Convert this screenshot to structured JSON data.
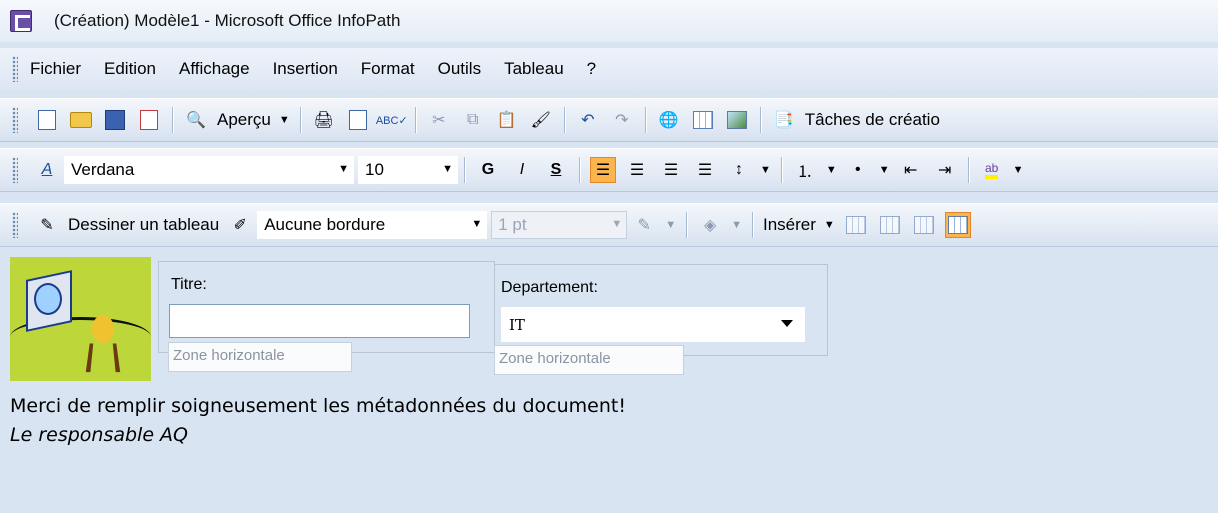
{
  "window": {
    "title": "(Création) Modèle1 - Microsoft Office InfoPath"
  },
  "menu": {
    "items": [
      {
        "label": "Fichier"
      },
      {
        "label": "Edition"
      },
      {
        "label": "Affichage"
      },
      {
        "label": "Insertion"
      },
      {
        "label": "Format"
      },
      {
        "label": "Outils"
      },
      {
        "label": "Tableau"
      },
      {
        "label": "?"
      }
    ]
  },
  "toolbar_standard": {
    "preview_label": "Aperçu",
    "tasks_label": "Tâches de créatio"
  },
  "toolbar_format": {
    "font_name": "Verdana",
    "font_size": "10",
    "bold_label": "G",
    "italic_label": "I",
    "underline_label": "S"
  },
  "toolbar_table": {
    "draw_table_label": "Dessiner un tableau",
    "border_style": "Aucune bordure",
    "border_width": "1 pt",
    "insert_label": "Insérer"
  },
  "form": {
    "titre_label": "Titre:",
    "titre_value": "",
    "departement_label": "Departement:",
    "departement_value": "IT",
    "zone_label_1": "Zone horizontale",
    "zone_label_2": "Zone horizontale",
    "message": "Merci de remplir soigneusement les métadonnées du document!",
    "signature": "Le responsable AQ"
  },
  "icons": [
    "infopath-app-icon",
    "new-icon",
    "open-icon",
    "save-icon",
    "publish-icon",
    "preview-icon",
    "print-icon",
    "print-preview-icon",
    "spellcheck-icon",
    "cut-icon",
    "copy-icon",
    "paste-icon",
    "format-painter-icon",
    "undo-icon",
    "redo-icon",
    "hyperlink-icon",
    "table-icon",
    "picture-icon",
    "design-tasks-icon",
    "font-style-icon",
    "align-left-icon",
    "align-center-icon",
    "align-right-icon",
    "justify-icon",
    "line-spacing-icon",
    "numbered-list-icon",
    "bullet-list-icon",
    "decrease-indent-icon",
    "increase-indent-icon",
    "highlight-icon",
    "draw-table-icon",
    "eraser-icon",
    "border-color-icon",
    "shading-icon",
    "insert-table-icon",
    "merge-cells-icon",
    "split-cells-icon",
    "table-properties-icon"
  ],
  "colors": {
    "active_button": "#fbb54c",
    "workspace": "#d8e4f2"
  }
}
